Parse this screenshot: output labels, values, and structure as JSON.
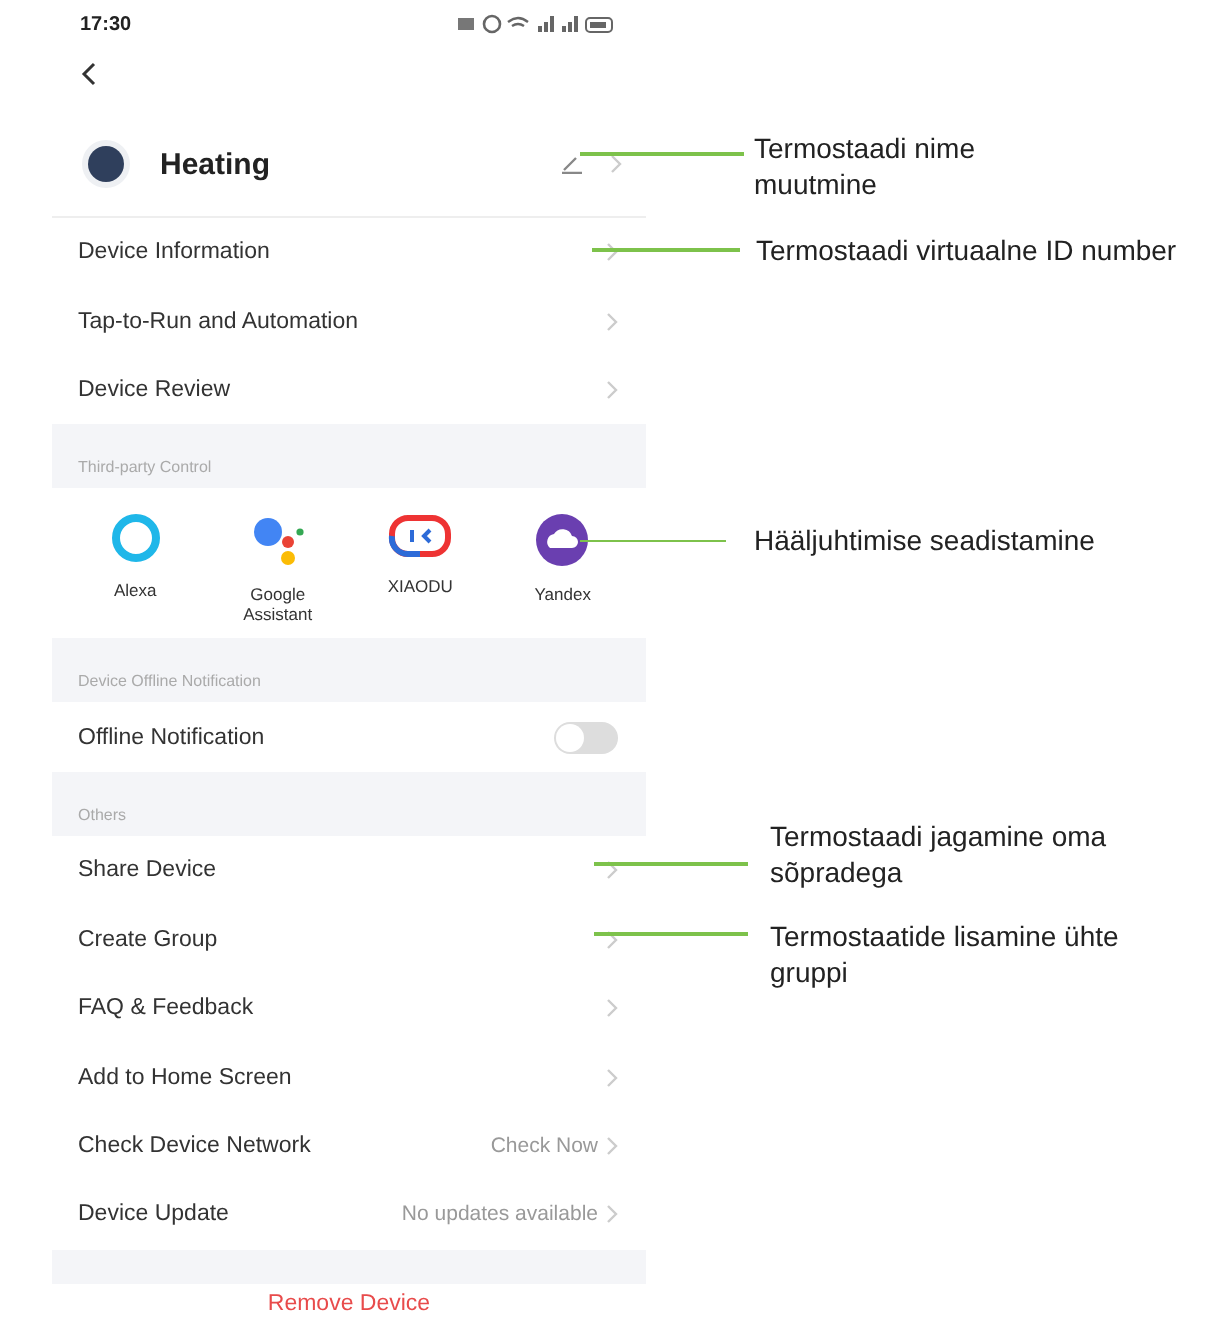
{
  "status_bar": {
    "time": "17:30"
  },
  "device": {
    "name": "Heating"
  },
  "menu_top": [
    {
      "label": "Device Information"
    },
    {
      "label": "Tap-to-Run and Automation"
    },
    {
      "label": "Device Review"
    }
  ],
  "third_party": {
    "heading": "Third-party Control",
    "services": [
      {
        "name": "Alexa",
        "kind": "alexa"
      },
      {
        "name": "Google Assistant",
        "kind": "google"
      },
      {
        "name": "XIAODU",
        "kind": "xiaodu"
      },
      {
        "name": "Yandex",
        "kind": "yandex"
      }
    ]
  },
  "offline": {
    "heading": "Device Offline Notification",
    "label": "Offline Notification",
    "on": false
  },
  "others": {
    "heading": "Others",
    "items": [
      {
        "label": "Share Device"
      },
      {
        "label": "Create Group"
      },
      {
        "label": "FAQ & Feedback"
      },
      {
        "label": "Add to Home Screen"
      },
      {
        "label": "Check Device Network",
        "value": "Check Now"
      },
      {
        "label": "Device Update",
        "value": "No updates available"
      }
    ]
  },
  "remove_button": "Remove Device",
  "annotations": [
    {
      "text": "Termostaadi nime muutmine"
    },
    {
      "text": "Termostaadi virtuaalne ID number"
    },
    {
      "text": "Hääljuhtimise seadistamine"
    },
    {
      "text": "Termostaadi jagamine oma sõpradega"
    },
    {
      "text": "Termostaatide lisamine ühte gruppi"
    }
  ]
}
